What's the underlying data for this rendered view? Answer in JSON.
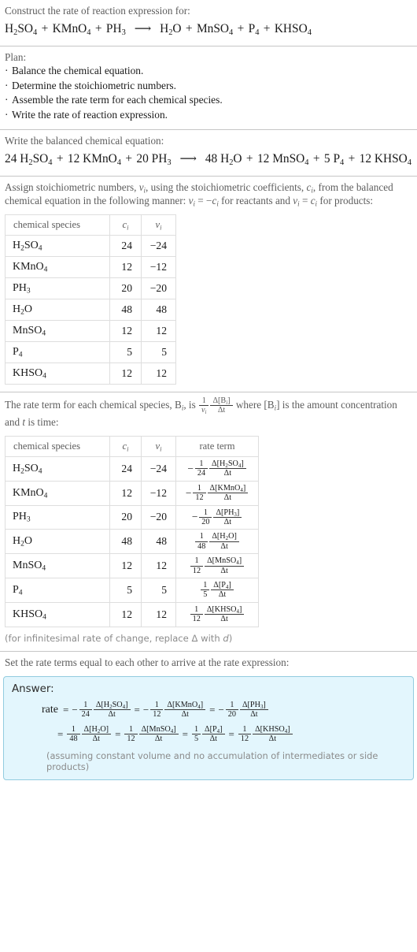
{
  "question": {
    "prompt": "Construct the rate of reaction expression for:",
    "reactants": [
      "H2SO4",
      "KMnO4",
      "PH3"
    ],
    "products": [
      "H2O",
      "MnSO4",
      "P4",
      "KHSO4"
    ],
    "arrow": "⟶"
  },
  "plan": {
    "title": "Plan:",
    "steps": [
      "Balance the chemical equation.",
      "Determine the stoichiometric numbers.",
      "Assemble the rate term for each chemical species.",
      "Write the rate of reaction expression."
    ]
  },
  "balanced": {
    "prompt": "Write the balanced chemical equation:",
    "reactants": [
      {
        "coef": "24",
        "formula": "H2SO4"
      },
      {
        "coef": "12",
        "formula": "KMnO4"
      },
      {
        "coef": "20",
        "formula": "PH3"
      }
    ],
    "products": [
      {
        "coef": "48",
        "formula": "H2O"
      },
      {
        "coef": "12",
        "formula": "MnSO4"
      },
      {
        "coef": "5",
        "formula": "P4"
      },
      {
        "coef": "12",
        "formula": "KHSO4"
      }
    ]
  },
  "stoich": {
    "prompt_part1": "Assign stoichiometric numbers, ",
    "prompt_vi": "ν",
    "prompt_part2": ", using the stoichiometric coefficients, ",
    "prompt_ci": "c",
    "prompt_part3": ", from the balanced chemical equation in the following manner: ",
    "prompt_rule_reactants": "ν",
    "prompt_part4": " = −c",
    "prompt_part5": " for reactants and ",
    "prompt_part6": " = c",
    "prompt_part7": " for products:",
    "headers": [
      "chemical species",
      "c_i",
      "ν_i"
    ],
    "rows": [
      {
        "species": "H2SO4",
        "ci": "24",
        "vi": "−24"
      },
      {
        "species": "KMnO4",
        "ci": "12",
        "vi": "−12"
      },
      {
        "species": "PH3",
        "ci": "20",
        "vi": "−20"
      },
      {
        "species": "H2O",
        "ci": "48",
        "vi": "48"
      },
      {
        "species": "MnSO4",
        "ci": "12",
        "vi": "12"
      },
      {
        "species": "P4",
        "ci": "5",
        "vi": "5"
      },
      {
        "species": "KHSO4",
        "ci": "12",
        "vi": "12"
      }
    ]
  },
  "rateterm": {
    "prompt_a": "The rate term for each chemical species, B",
    "prompt_b": ", is ",
    "prompt_c": " where [B",
    "prompt_d": "] is the amount concentration and ",
    "prompt_e": " is time:",
    "headers": [
      "chemical species",
      "c_i",
      "ν_i",
      "rate term"
    ],
    "rows": [
      {
        "species": "H2SO4",
        "ci": "24",
        "vi": "−24",
        "sign": "−",
        "denom": "24",
        "delta": "Δ[H2SO4]"
      },
      {
        "species": "KMnO4",
        "ci": "12",
        "vi": "−12",
        "sign": "−",
        "denom": "12",
        "delta": "Δ[KMnO4]"
      },
      {
        "species": "PH3",
        "ci": "20",
        "vi": "−20",
        "sign": "−",
        "denom": "20",
        "delta": "Δ[PH3]"
      },
      {
        "species": "H2O",
        "ci": "48",
        "vi": "48",
        "sign": "",
        "denom": "48",
        "delta": "Δ[H2O]"
      },
      {
        "species": "MnSO4",
        "ci": "12",
        "vi": "12",
        "sign": "",
        "denom": "12",
        "delta": "Δ[MnSO4]"
      },
      {
        "species": "P4",
        "ci": "5",
        "vi": "5",
        "sign": "",
        "denom": "5",
        "delta": "Δ[P4]"
      },
      {
        "species": "KHSO4",
        "ci": "12",
        "vi": "12",
        "sign": "",
        "denom": "12",
        "delta": "Δ[KHSO4]"
      }
    ],
    "footnote": "(for infinitesimal rate of change, replace Δ with d)"
  },
  "final": {
    "prompt": "Set the rate terms equal to each other to arrive at the rate expression:",
    "answer_label": "Answer:",
    "rate_word": "rate",
    "terms": [
      {
        "sign": "−",
        "denom": "24",
        "delta": "Δ[H2SO4]"
      },
      {
        "sign": "−",
        "denom": "12",
        "delta": "Δ[KMnO4]"
      },
      {
        "sign": "−",
        "denom": "20",
        "delta": "Δ[PH3]"
      },
      {
        "sign": "",
        "denom": "48",
        "delta": "Δ[H2O]"
      },
      {
        "sign": "",
        "denom": "12",
        "delta": "Δ[MnSO4]"
      },
      {
        "sign": "",
        "denom": "5",
        "delta": "Δ[P4]"
      },
      {
        "sign": "",
        "denom": "12",
        "delta": "Δ[KHSO4]"
      }
    ],
    "note": "(assuming constant volume and no accumulation of intermediates or side products)"
  },
  "symbols": {
    "one": "1",
    "dt": "Δt",
    "equals": "=",
    "plus": "+"
  },
  "colors": {
    "answer_border": "#92ccdf",
    "answer_bg": "#e3f6fd",
    "prompt_text": "#5d5d5d",
    "divider": "#c6c6c6",
    "table_border": "#dedede"
  }
}
